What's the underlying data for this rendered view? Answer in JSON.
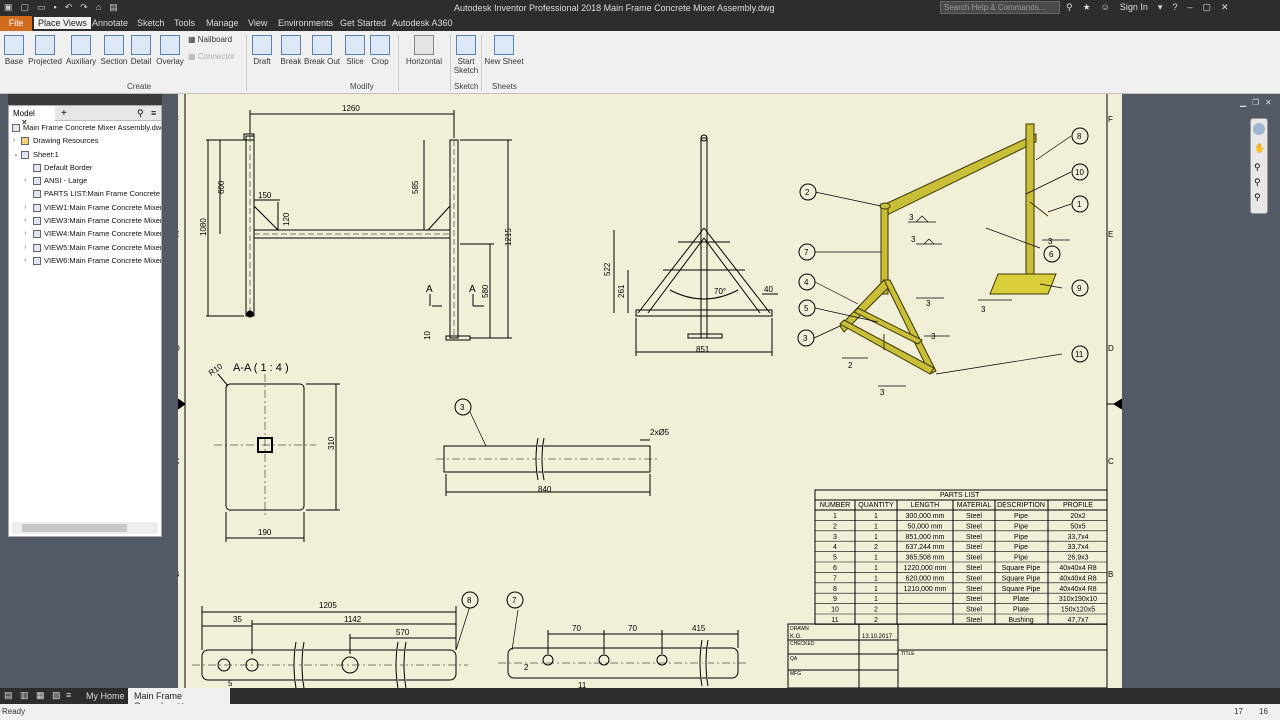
{
  "app_title": "Autodesk Inventor Professional 2018    Main Frame Concrete Mixer Assembly.dwg",
  "search_placeholder": "Search Help & Commands...",
  "sign_in": "Sign In",
  "menu_tabs": [
    "File",
    "Place Views",
    "Annotate",
    "Sketch",
    "Tools",
    "Manage",
    "View",
    "Environments",
    "Get Started",
    "Autodesk A360"
  ],
  "ribbon": {
    "create_buttons": [
      "Base",
      "Projected",
      "Auxiliary",
      "Section",
      "Detail",
      "Overlay"
    ],
    "nailboard": "Nailboard",
    "connector": "Connector",
    "create_group": "Create",
    "modify_buttons": [
      "Draft",
      "Break",
      "Break Out",
      "Slice",
      "Crop"
    ],
    "modify_group": "Modify",
    "horizontal": "Horizontal",
    "start_sketch": "Start Sketch",
    "sketch_group": "Sketch",
    "new_sheet": "New Sheet",
    "sheets_group": "Sheets"
  },
  "browser": {
    "tab": "Model",
    "items": [
      "Main Frame Concrete Mixer Assembly.dwg",
      "Drawing Resources",
      "Sheet:1",
      "Default Border",
      "ANSI - Large",
      "PARTS LIST:Main Frame Concrete Mi",
      "VIEW1:Main Frame Concrete Mixer A",
      "VIEW3:Main Frame Concrete Mixer A",
      "VIEW4:Main Frame Concrete Mixer A",
      "VIEW5:Main Frame Concrete Mixer A",
      "VIEW6:Main Frame Concrete Mixer A"
    ]
  },
  "drawing": {
    "dims_front": [
      "1260",
      "600",
      "150",
      "120",
      "1080",
      "585",
      "1215",
      "580",
      "10",
      "A",
      "A"
    ],
    "dims_side": [
      "522",
      "261",
      "70°",
      "40",
      "851"
    ],
    "section_title": "A-A ( 1 : 4 )",
    "section_dims": [
      "R10",
      "310",
      "190"
    ],
    "pipe_dims": [
      "2xØ5",
      "840"
    ],
    "bottom_left_dims": [
      "1205",
      "35",
      "1142",
      "570",
      "5"
    ],
    "bottom_mid_dims": [
      "70",
      "70",
      "415",
      "2",
      "11"
    ],
    "balloons": [
      "1",
      "2",
      "3",
      "4",
      "5",
      "6",
      "7",
      "8",
      "9",
      "10",
      "11",
      "3",
      "8",
      "7"
    ],
    "weld_labels": [
      "3",
      "3",
      "3",
      "3",
      "3",
      "2",
      "3",
      "3"
    ],
    "zone_letters_left": [
      "F",
      "E",
      "D",
      "C",
      "B"
    ],
    "zone_letters_right": [
      "F",
      "E",
      "D",
      "C",
      "B"
    ]
  },
  "parts_list": {
    "title": "PARTS LIST",
    "headers": [
      "NUMBER",
      "QUANTITY",
      "LENGTH",
      "MATERIAL",
      "DESCRIPTION",
      "PROFILE"
    ],
    "rows": [
      [
        "1",
        "1",
        "300,000 mm",
        "Steel",
        "Pipe",
        "20x2"
      ],
      [
        "2",
        "1",
        "50,000 mm",
        "Steel",
        "Pipe",
        "50x5"
      ],
      [
        "3",
        "1",
        "851,000 mm",
        "Steel",
        "Pipe",
        "33,7x4"
      ],
      [
        "4",
        "2",
        "637,244 mm",
        "Steel",
        "Pipe",
        "33,7x4"
      ],
      [
        "5",
        "1",
        "365,508 mm",
        "Steel",
        "Pipe",
        "26,9x3"
      ],
      [
        "6",
        "1",
        "1220,000 mm",
        "Steel",
        "Square Pipe",
        "40x40x4 R8"
      ],
      [
        "7",
        "1",
        "620,000 mm",
        "Steel",
        "Square Pipe",
        "40x40x4 R8"
      ],
      [
        "8",
        "1",
        "1210,000 mm",
        "Steel",
        "Square Pipe",
        "40x40x4 R8"
      ],
      [
        "9",
        "1",
        "",
        "Steel",
        "Plate",
        "310x190x10"
      ],
      [
        "10",
        "2",
        "",
        "Steel",
        "Plate",
        "150x120x5"
      ],
      [
        "11",
        "2",
        "",
        "Steel",
        "Bushing",
        "47,7x7"
      ]
    ]
  },
  "title_block": {
    "drawn": "DRAWN",
    "drawn_by": "K.G.",
    "date": "13.10.2017",
    "checked": "CHECKED",
    "qa": "QA",
    "mfg": "MFG",
    "title": "TITLE"
  },
  "bottom_tabs": [
    "My Home",
    "Main Frame Con...dwg"
  ],
  "status": {
    "left": "Ready",
    "n1": "17",
    "n2": "16"
  }
}
